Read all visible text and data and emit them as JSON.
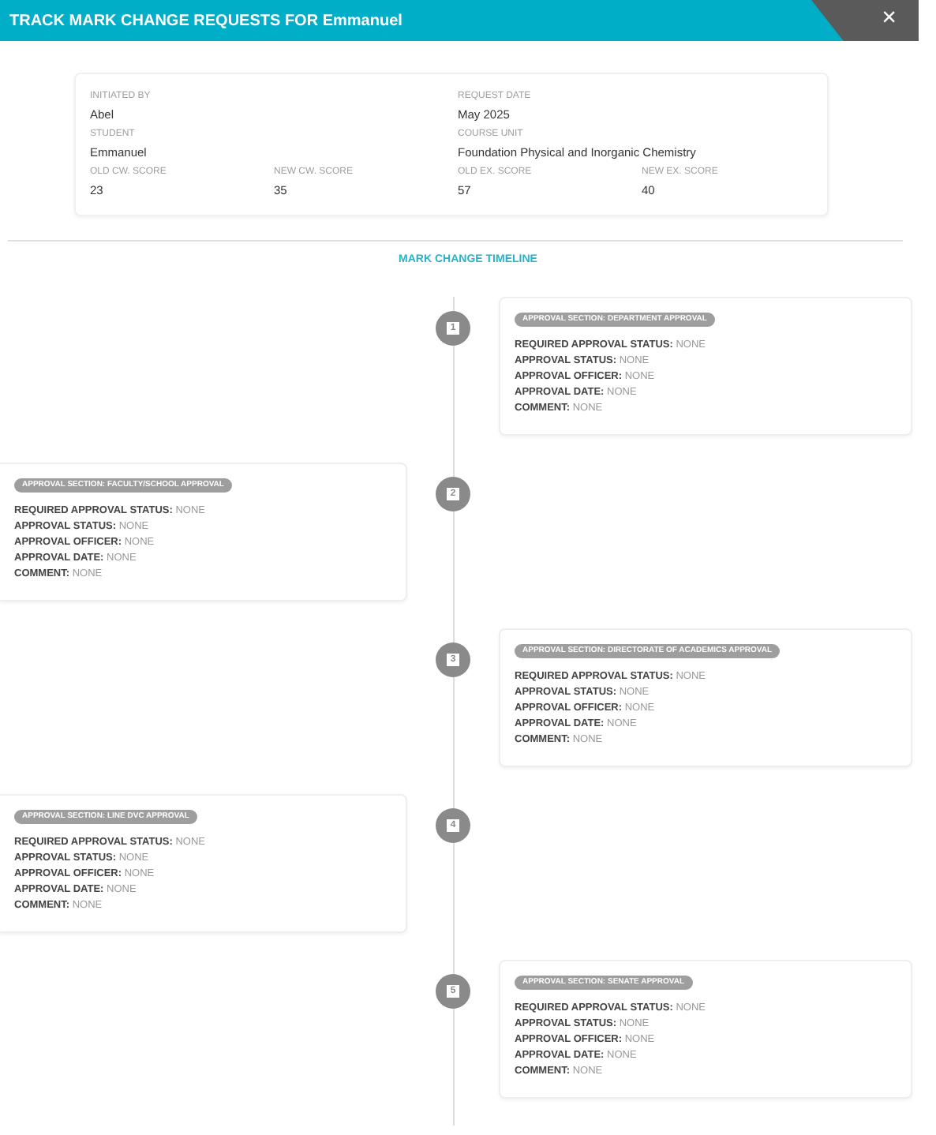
{
  "window": {
    "title": "TRACK MARK CHANGE REQUESTS FOR Emmanuel",
    "close": "×"
  },
  "details": [
    {
      "label": "INITIATED BY",
      "value": "Abel"
    },
    {
      "label": "REQUEST DATE",
      "value": "May 2025"
    },
    {
      "label": "STUDENT",
      "value": "Emmanuel"
    },
    {
      "label": "COURSE UNIT",
      "value": "Foundation Physical and Inorganic Chemistry"
    },
    {
      "label": "OLD CW. SCORE",
      "value": "23"
    },
    {
      "label": "NEW CW. SCORE",
      "value": "35"
    },
    {
      "label": "OLD EX. SCORE",
      "value": "57"
    },
    {
      "label": "NEW EX. SCORE",
      "value": "40"
    }
  ],
  "timeline": {
    "heading": "MARK CHANGE TIMELINE",
    "items": [
      {
        "number": "1",
        "kind": "right",
        "section": "APPROVAL SECTION: DEPARTMENT APPROVAL",
        "fields": [
          {
            "label": "REQUIRED APPROVAL STATUS:",
            "value": "NONE"
          },
          {
            "label": "APPROVAL STATUS:",
            "value": "NONE"
          },
          {
            "label": "APPROVAL OFFICER:",
            "value": "NONE"
          },
          {
            "label": "APPROVAL DATE:",
            "value": "NONE"
          },
          {
            "label": "COMMENT:",
            "value": "NONE"
          }
        ]
      },
      {
        "number": "2",
        "kind": "left",
        "section": "APPROVAL SECTION: FACULTY/SCHOOL APPROVAL",
        "fields": [
          {
            "label": "REQUIRED APPROVAL STATUS:",
            "value": "NONE"
          },
          {
            "label": "APPROVAL STATUS:",
            "value": "NONE"
          },
          {
            "label": "APPROVAL OFFICER:",
            "value": "NONE"
          },
          {
            "label": "APPROVAL DATE:",
            "value": "NONE"
          },
          {
            "label": "COMMENT:",
            "value": "NONE"
          }
        ]
      },
      {
        "number": "3",
        "kind": "right",
        "section": "APPROVAL SECTION: DIRECTORATE OF ACADEMICS APPROVAL",
        "fields": [
          {
            "label": "REQUIRED APPROVAL STATUS:",
            "value": "NONE"
          },
          {
            "label": "APPROVAL STATUS:",
            "value": "NONE"
          },
          {
            "label": "APPROVAL OFFICER:",
            "value": "NONE"
          },
          {
            "label": "APPROVAL DATE:",
            "value": "NONE"
          },
          {
            "label": "COMMENT:",
            "value": "NONE"
          }
        ]
      },
      {
        "number": "4",
        "kind": "left",
        "section": "APPROVAL SECTION: LINE DVC APPROVAL",
        "fields": [
          {
            "label": "REQUIRED APPROVAL STATUS:",
            "value": "NONE"
          },
          {
            "label": "APPROVAL STATUS:",
            "value": "NONE"
          },
          {
            "label": "APPROVAL OFFICER:",
            "value": "NONE"
          },
          {
            "label": "APPROVAL DATE:",
            "value": "NONE"
          },
          {
            "label": "COMMENT:",
            "value": "NONE"
          }
        ]
      },
      {
        "number": "5",
        "kind": "right",
        "section": "APPROVAL SECTION: SENATE APPROVAL",
        "fields": [
          {
            "label": "REQUIRED APPROVAL STATUS:",
            "value": "NONE"
          },
          {
            "label": "APPROVAL STATUS:",
            "value": "NONE"
          },
          {
            "label": "APPROVAL OFFICER:",
            "value": "NONE"
          },
          {
            "label": "APPROVAL DATE:",
            "value": "NONE"
          },
          {
            "label": "COMMENT:",
            "value": "NONE"
          }
        ]
      }
    ]
  }
}
